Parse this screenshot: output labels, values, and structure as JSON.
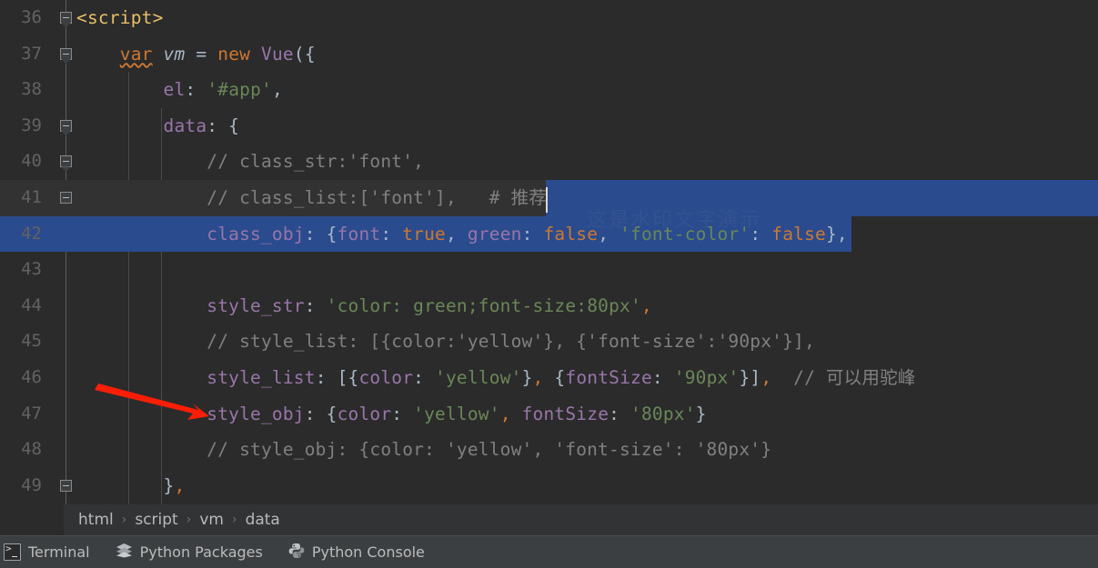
{
  "app": {
    "theme": "darcula",
    "editor_bg": "#2b2b2b",
    "selection_bg": "#2a4b8d",
    "caret_color": "#d9d9d9",
    "annotation_arrow_color": "#ff2200"
  },
  "editor": {
    "language": "html-vue-javascript",
    "first_visible_line": 36,
    "lines": [
      {
        "number": "36",
        "fold": "collapse",
        "selected": false,
        "current": false,
        "tokens": [
          {
            "text": "<script>",
            "cls": "t-tag"
          }
        ]
      },
      {
        "number": "37",
        "fold": "collapse",
        "selected": false,
        "current": false,
        "tokens": [
          {
            "text": "    ",
            "cls": "t-plain"
          },
          {
            "text": "var",
            "cls": "t-kw squiggle"
          },
          {
            "text": " ",
            "cls": "t-plain"
          },
          {
            "text": "vm",
            "cls": "t-var-def"
          },
          {
            "text": " = ",
            "cls": "t-plain"
          },
          {
            "text": "new",
            "cls": "t-kw"
          },
          {
            "text": " ",
            "cls": "t-plain"
          },
          {
            "text": "Vue",
            "cls": "t-prop"
          },
          {
            "text": "({",
            "cls": "t-plain"
          }
        ]
      },
      {
        "number": "38",
        "fold": "none",
        "selected": false,
        "current": false,
        "tokens": [
          {
            "text": "        ",
            "cls": "t-plain"
          },
          {
            "text": "el",
            "cls": "t-prop"
          },
          {
            "text": ": ",
            "cls": "t-plain"
          },
          {
            "text": "'#app'",
            "cls": "t-str"
          },
          {
            "text": ",",
            "cls": "t-plain"
          }
        ]
      },
      {
        "number": "39",
        "fold": "collapse",
        "selected": false,
        "current": false,
        "tokens": [
          {
            "text": "        ",
            "cls": "t-plain"
          },
          {
            "text": "data",
            "cls": "t-prop"
          },
          {
            "text": ": {",
            "cls": "t-plain"
          }
        ]
      },
      {
        "number": "40",
        "fold": "collapse",
        "selected": false,
        "current": false,
        "tokens": [
          {
            "text": "            // class_str:'font',",
            "cls": "t-comment"
          }
        ]
      },
      {
        "number": "41",
        "fold": "collapse-end",
        "selected": true,
        "current": true,
        "tokens": [
          {
            "text": "            // class_list:['font'],   # 推荐",
            "cls": "t-comment"
          }
        ]
      },
      {
        "number": "42",
        "fold": "none",
        "selected": true,
        "current": false,
        "tokens": [
          {
            "text": "            ",
            "cls": "t-plain"
          },
          {
            "text": "class_obj",
            "cls": "t-prop"
          },
          {
            "text": ": {",
            "cls": "t-plain"
          },
          {
            "text": "font",
            "cls": "t-prop"
          },
          {
            "text": ": ",
            "cls": "t-plain"
          },
          {
            "text": "true",
            "cls": "t-kw"
          },
          {
            "text": ", ",
            "cls": "t-plain"
          },
          {
            "text": "green",
            "cls": "t-prop"
          },
          {
            "text": ": ",
            "cls": "t-plain"
          },
          {
            "text": "false",
            "cls": "t-kw"
          },
          {
            "text": ", ",
            "cls": "t-plain"
          },
          {
            "text": "'font-color'",
            "cls": "t-str"
          },
          {
            "text": ": ",
            "cls": "t-plain"
          },
          {
            "text": "false",
            "cls": "t-kw"
          },
          {
            "text": "},",
            "cls": "t-plain"
          }
        ]
      },
      {
        "number": "43",
        "fold": "none",
        "selected": false,
        "current": false,
        "tokens": []
      },
      {
        "number": "44",
        "fold": "none",
        "selected": false,
        "current": false,
        "tokens": [
          {
            "text": "            ",
            "cls": "t-plain"
          },
          {
            "text": "style_str",
            "cls": "t-prop"
          },
          {
            "text": ": ",
            "cls": "t-plain"
          },
          {
            "text": "'color: green;font-size:80px'",
            "cls": "t-str"
          },
          {
            "text": ",",
            "cls": "t-comma"
          }
        ]
      },
      {
        "number": "45",
        "fold": "none",
        "selected": false,
        "current": false,
        "tokens": [
          {
            "text": "            // style_list: [{color:'yellow'}, {'font-size':'90px'}],",
            "cls": "t-comment"
          }
        ]
      },
      {
        "number": "46",
        "fold": "none",
        "selected": false,
        "current": false,
        "tokens": [
          {
            "text": "            ",
            "cls": "t-plain"
          },
          {
            "text": "style_list",
            "cls": "t-prop"
          },
          {
            "text": ": [{",
            "cls": "t-plain"
          },
          {
            "text": "color",
            "cls": "t-prop"
          },
          {
            "text": ": ",
            "cls": "t-plain"
          },
          {
            "text": "'yellow'",
            "cls": "t-str"
          },
          {
            "text": "}",
            "cls": "t-plain"
          },
          {
            "text": ",",
            "cls": "t-comma"
          },
          {
            "text": " {",
            "cls": "t-plain"
          },
          {
            "text": "fontSize",
            "cls": "t-prop"
          },
          {
            "text": ": ",
            "cls": "t-plain"
          },
          {
            "text": "'90px'",
            "cls": "t-str"
          },
          {
            "text": "}]",
            "cls": "t-plain"
          },
          {
            "text": ",",
            "cls": "t-comma"
          },
          {
            "text": "  // 可以用驼峰",
            "cls": "t-comment"
          }
        ]
      },
      {
        "number": "47",
        "fold": "none",
        "selected": false,
        "current": false,
        "tokens": [
          {
            "text": "            ",
            "cls": "t-plain"
          },
          {
            "text": "style_obj",
            "cls": "t-prop"
          },
          {
            "text": ": {",
            "cls": "t-plain"
          },
          {
            "text": "color",
            "cls": "t-prop"
          },
          {
            "text": ": ",
            "cls": "t-plain"
          },
          {
            "text": "'yellow'",
            "cls": "t-str"
          },
          {
            "text": ",",
            "cls": "t-comma"
          },
          {
            "text": " ",
            "cls": "t-plain"
          },
          {
            "text": "fontSize",
            "cls": "t-prop"
          },
          {
            "text": ": ",
            "cls": "t-plain"
          },
          {
            "text": "'80px'",
            "cls": "t-str"
          },
          {
            "text": "}",
            "cls": "t-plain"
          }
        ]
      },
      {
        "number": "48",
        "fold": "none",
        "selected": false,
        "current": false,
        "tokens": [
          {
            "text": "            // style_obj: {color: 'yellow', 'font-size': '80px'}",
            "cls": "t-comment"
          }
        ]
      },
      {
        "number": "49",
        "fold": "collapse-end",
        "selected": false,
        "current": false,
        "tokens": [
          {
            "text": "        }",
            "cls": "t-plain"
          },
          {
            "text": ",",
            "cls": "t-comma"
          }
        ]
      }
    ],
    "watermark_text": "这是水印文字演示"
  },
  "breadcrumb": {
    "separator": "›",
    "items": [
      {
        "label": "html"
      },
      {
        "label": "script"
      },
      {
        "label": "vm"
      },
      {
        "label": "data"
      }
    ]
  },
  "statusbar": {
    "items": [
      {
        "icon": "terminal-icon",
        "label": "Terminal"
      },
      {
        "icon": "python-packages-icon",
        "label": "Python Packages"
      },
      {
        "icon": "python-console-icon",
        "label": "Python Console"
      }
    ]
  }
}
